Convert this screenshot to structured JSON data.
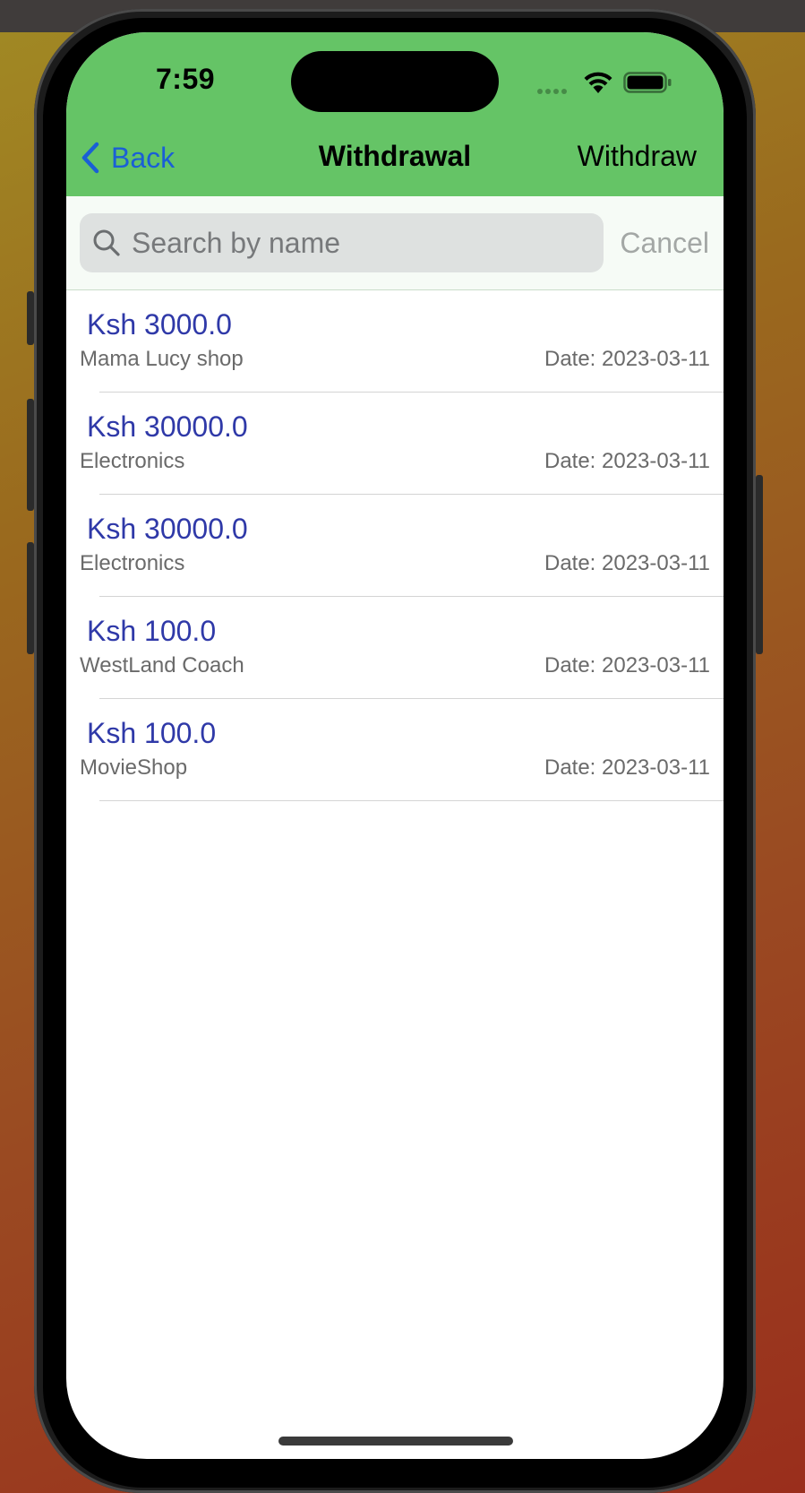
{
  "status_bar": {
    "time": "7:59",
    "icons": [
      "cellular-dots-icon",
      "wifi-icon",
      "battery-icon"
    ]
  },
  "nav": {
    "back_label": "Back",
    "title": "Withdrawal",
    "action_label": "Withdraw"
  },
  "search": {
    "placeholder": "Search by name",
    "value": "",
    "cancel_label": "Cancel"
  },
  "withdrawals": [
    {
      "amount": "Ksh 3000.0",
      "name": "Mama Lucy shop",
      "date": "Date: 2023-03-11"
    },
    {
      "amount": "Ksh 30000.0",
      "name": "Electronics",
      "date": "Date: 2023-03-11"
    },
    {
      "amount": "Ksh 30000.0",
      "name": "Electronics",
      "date": "Date: 2023-03-11"
    },
    {
      "amount": "Ksh 100.0",
      "name": "WestLand Coach",
      "date": "Date: 2023-03-11"
    },
    {
      "amount": "Ksh 100.0",
      "name": "MovieShop",
      "date": "Date: 2023-03-11"
    }
  ],
  "colors": {
    "nav_background": "#65c466",
    "link_blue": "#1a5fd6",
    "amount_blue": "#2f39a8",
    "secondary_text": "#6a6a6a",
    "search_background": "#f6fbf6"
  }
}
